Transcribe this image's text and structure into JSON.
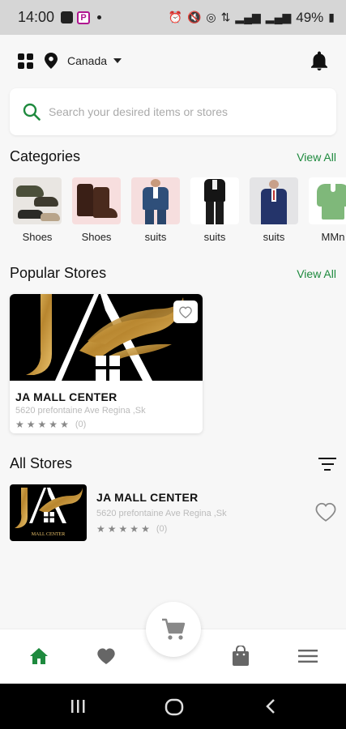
{
  "status_bar": {
    "time": "14:00",
    "battery": "49%"
  },
  "topbar": {
    "country": "Canada"
  },
  "search": {
    "placeholder": "Search your desired items or stores"
  },
  "categories_section": {
    "title": "Categories",
    "view_all": "View All",
    "items": [
      {
        "label": "Shoes",
        "icon": "loafers-image"
      },
      {
        "label": "Shoes",
        "icon": "boots-image"
      },
      {
        "label": "suits",
        "icon": "blue-suit-image"
      },
      {
        "label": "suits",
        "icon": "black-suit-image"
      },
      {
        "label": "suits",
        "icon": "navy-suit-image"
      },
      {
        "label": "MMn",
        "icon": "green-scrubs-image"
      }
    ]
  },
  "popular_section": {
    "title": "Popular Stores",
    "view_all": "View All",
    "store": {
      "name": "JA MALL CENTER",
      "address": "5620 prefontaine Ave Regina ,Sk",
      "rating_count": "(0)"
    }
  },
  "all_stores_section": {
    "title": "All Stores",
    "stores": [
      {
        "name": "JA MALL CENTER",
        "address": "5620 prefontaine Ave Regina ,Sk",
        "rating_count": "(0)",
        "logo_caption": "MALL CENTER"
      }
    ]
  },
  "colors": {
    "accent": "#1e8a3e",
    "nav_inactive": "#666666",
    "brand_gold": "#c9a24a"
  }
}
